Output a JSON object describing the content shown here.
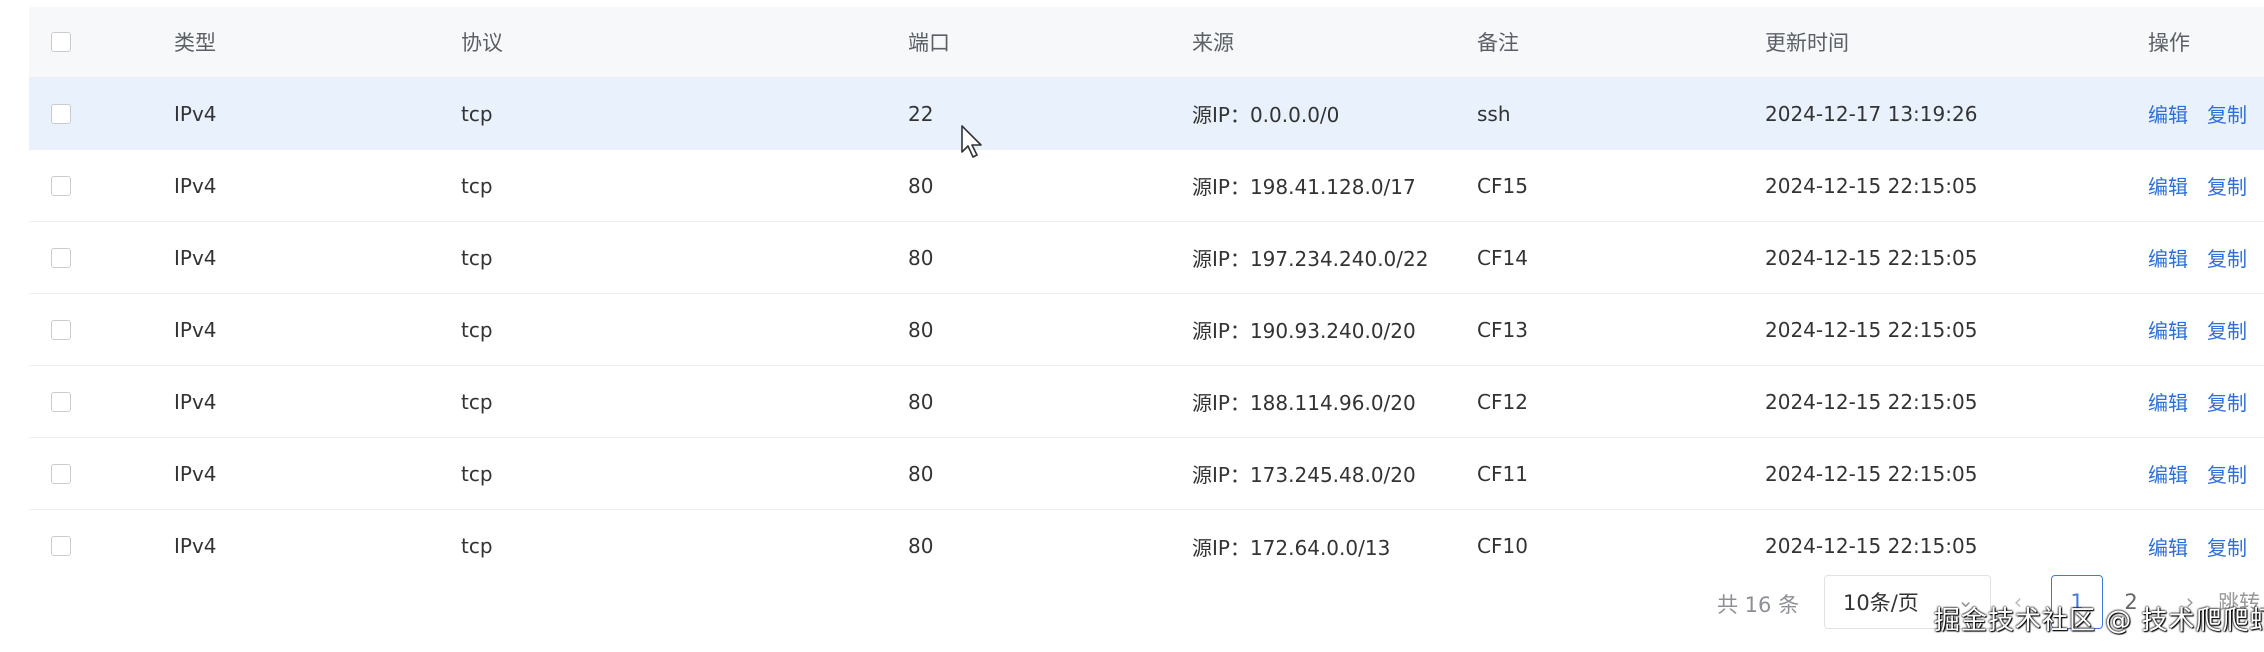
{
  "table": {
    "headers": {
      "type": "类型",
      "protocol": "协议",
      "port": "端口",
      "source": "来源",
      "note": "备注",
      "updated": "更新时间",
      "actions": "操作"
    },
    "rows": [
      {
        "type": "IPv4",
        "protocol": "tcp",
        "port": "22",
        "source": "源IP：0.0.0.0/0",
        "note": "ssh",
        "updated": "2024-12-17 13:19:26",
        "edit": "编辑",
        "copy": "复制"
      },
      {
        "type": "IPv4",
        "protocol": "tcp",
        "port": "80",
        "source": "源IP：198.41.128.0/17",
        "note": "CF15",
        "updated": "2024-12-15 22:15:05",
        "edit": "编辑",
        "copy": "复制"
      },
      {
        "type": "IPv4",
        "protocol": "tcp",
        "port": "80",
        "source": "源IP：197.234.240.0/22",
        "note": "CF14",
        "updated": "2024-12-15 22:15:05",
        "edit": "编辑",
        "copy": "复制"
      },
      {
        "type": "IPv4",
        "protocol": "tcp",
        "port": "80",
        "source": "源IP：190.93.240.0/20",
        "note": "CF13",
        "updated": "2024-12-15 22:15:05",
        "edit": "编辑",
        "copy": "复制"
      },
      {
        "type": "IPv4",
        "protocol": "tcp",
        "port": "80",
        "source": "源IP：188.114.96.0/20",
        "note": "CF12",
        "updated": "2024-12-15 22:15:05",
        "edit": "编辑",
        "copy": "复制"
      },
      {
        "type": "IPv4",
        "protocol": "tcp",
        "port": "80",
        "source": "源IP：173.245.48.0/20",
        "note": "CF11",
        "updated": "2024-12-15 22:15:05",
        "edit": "编辑",
        "copy": "复制"
      },
      {
        "type": "IPv4",
        "protocol": "tcp",
        "port": "80",
        "source": "源IP：172.64.0.0/13",
        "note": "CF10",
        "updated": "2024-12-15 22:15:05",
        "edit": "编辑",
        "copy": "复制"
      }
    ]
  },
  "pagination": {
    "total": "共 16 条",
    "page_size": "10条/页",
    "prev_icon": "‹",
    "page1": "1",
    "page2": "2",
    "next_icon": "›",
    "jump": "跳转"
  },
  "watermark": "掘金技术社区 @ 技术爬爬虾",
  "colors": {
    "link": "#2f6fd8",
    "selected_row": "#e9f1fd",
    "active_page": "#3a7be0"
  }
}
